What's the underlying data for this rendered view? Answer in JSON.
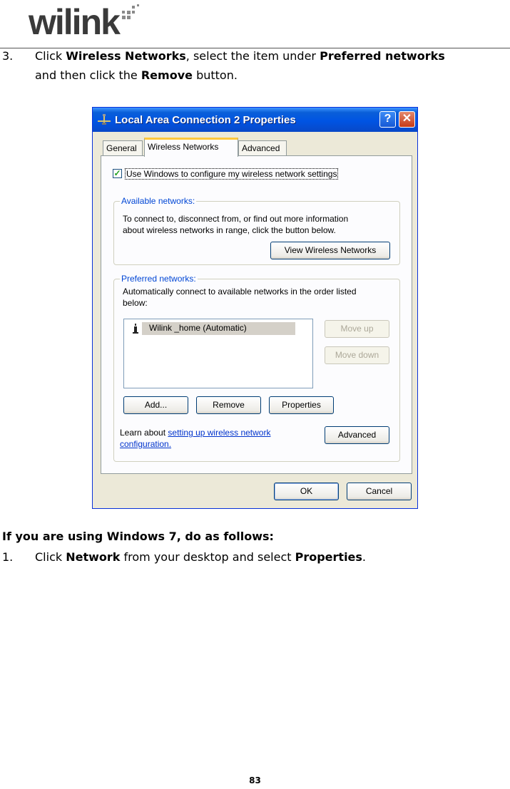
{
  "header": {
    "logo_text": "wilink"
  },
  "step3": {
    "number": "3.",
    "prefix": "Click ",
    "wireless_networks": "Wireless Networks",
    "middle": ", select the item under ",
    "preferred_networks": "Preferred networks",
    "line2_prefix": "and then click the ",
    "remove": "Remove",
    "line2_suffix": " button."
  },
  "dialog": {
    "title": "Local Area Connection 2 Properties",
    "help_glyph": "?",
    "close_glyph": "✕",
    "tabs": [
      "General",
      "Wireless Networks",
      "Advanced"
    ],
    "active_tab": "Wireless Networks",
    "use_windows_checkbox": {
      "label": "Use Windows to configure my wireless network settings",
      "checked": true,
      "check_glyph": "✓"
    },
    "available": {
      "title": "Available networks:",
      "line1": "To connect to, disconnect from, or find out more information",
      "line2": "about wireless networks in range, click the button below.",
      "button": "View Wireless Networks"
    },
    "preferred": {
      "title": "Preferred networks:",
      "line1": "Automatically connect to available networks in the order listed",
      "line2": "below:",
      "networks": [
        "Wilink _home (Automatic)"
      ],
      "move_up": "Move up",
      "move_down": "Move down",
      "add": "Add...",
      "remove": "Remove",
      "properties": "Properties",
      "learn_prefix": "Learn about ",
      "learn_link_1": "setting up wireless network",
      "learn_link_2": "configuration.",
      "advanced": "Advanced"
    },
    "ok": "OK",
    "cancel": "Cancel"
  },
  "windows7": {
    "heading": "If you are using Windows 7, do as follows:",
    "number": "1.",
    "prefix": "Click ",
    "network": "Network",
    "middle": " from your desktop and select ",
    "properties": "Properties",
    "suffix": "."
  },
  "footer": {
    "page_number": "83"
  },
  "colors": {
    "titlebar_blue": "#0054e3",
    "dialog_face": "#ece9d8",
    "group_title_blue": "#0046d5",
    "active_tab_accent": "#ffc83c",
    "link_blue": "#0033cc"
  }
}
